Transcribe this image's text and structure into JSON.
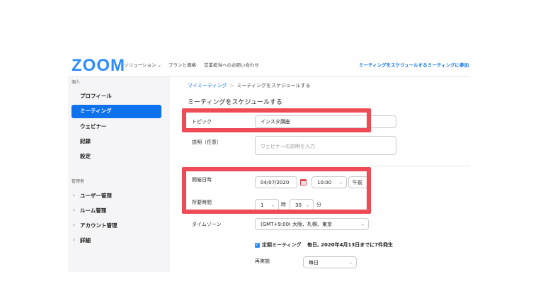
{
  "header": {
    "logo": "ZOOM",
    "nav_solutions": "ソリューション ⌄",
    "nav_plans": "プランと価格",
    "nav_contact_sales": "営業担当へのお問い合わせ",
    "nav_schedule": "ミーティングをスケジュールする",
    "nav_join": "ミーティングに参加"
  },
  "sidebar": {
    "personal_heading": "個人",
    "items": [
      "プロフィール",
      "ミーティング",
      "ウェビナー",
      "記録",
      "設定"
    ],
    "admin_heading": "管理者",
    "admin_items": [
      "ユーザー管理",
      "ルーム管理",
      "アカウント管理",
      "詳細"
    ]
  },
  "breadcrumb": {
    "link": "マイミーティング",
    "separator": ">",
    "current": "ミーティングをスケジュールする"
  },
  "form": {
    "title": "ミーティングをスケジュールする",
    "topic_label": "トピック",
    "topic_value": "インスタ講座",
    "description_label": "説明（任意）",
    "description_placeholder": "ウェビナーの説明を入力",
    "when_label": "開催日時",
    "date_value": "04/07/2020",
    "time_value": "10:00",
    "ampm_value": "午前",
    "duration_label": "所要時間",
    "duration_hours": "1",
    "hours_unit": "時",
    "duration_minutes": "30",
    "minutes_unit": "分",
    "timezone_label": "タイムゾーン",
    "timezone_value": "(GMT+9:00) 大阪、札幌、東京",
    "recurring_label": "定期ミーティング",
    "recurring_summary": "毎日, 2020年4月13日までに7件発生",
    "recurrence_label": "再実施",
    "recurrence_value": "毎日"
  },
  "icons": {
    "calendar": "calendar-icon",
    "chevron": "chevron-down-icon",
    "checkbox": "checkbox-checked-icon"
  },
  "colors": {
    "brand_blue": "#2d8cff",
    "active_blue": "#0e72ed",
    "highlight_red": "#ef4b57"
  }
}
